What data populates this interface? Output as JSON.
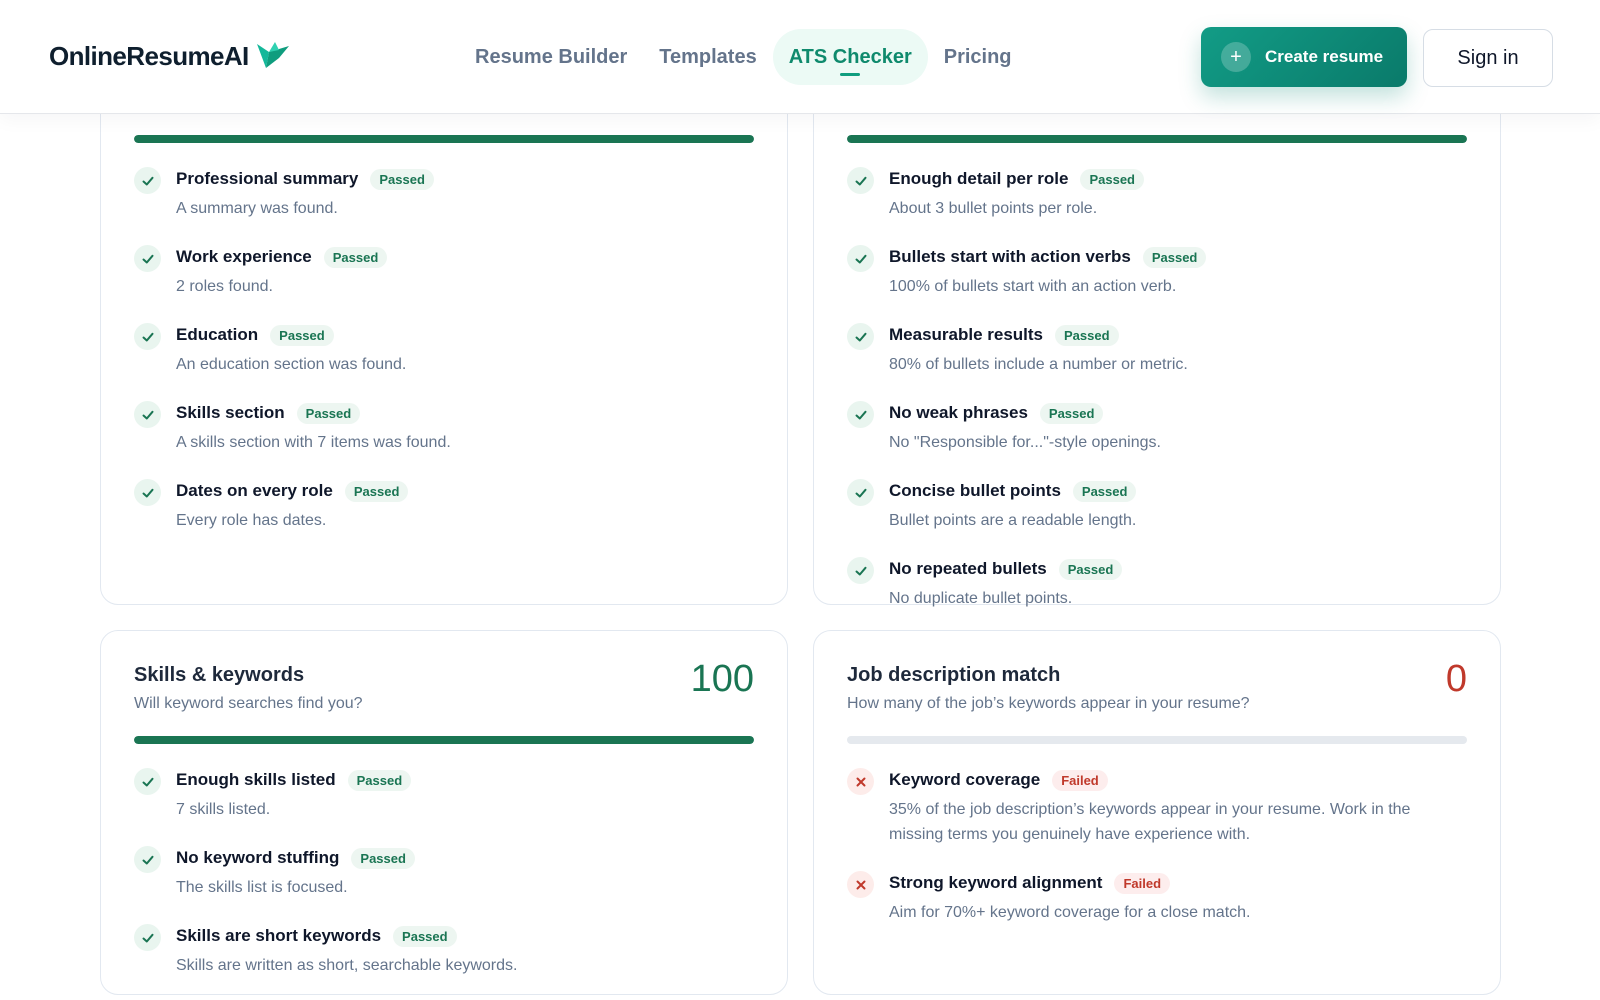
{
  "brand": {
    "name": "OnlineResumeAI",
    "accent": "#0f9d7e",
    "icon": "bird-logo-icon"
  },
  "nav": {
    "items": [
      {
        "label": "Resume Builder",
        "active": false
      },
      {
        "label": "Templates",
        "active": false
      },
      {
        "label": "ATS Checker",
        "active": true
      },
      {
        "label": "Pricing",
        "active": false
      }
    ]
  },
  "header_actions": {
    "create_label": "Create resume",
    "create_icon": "plus-icon",
    "signin_label": "Sign in"
  },
  "cards": {
    "sections": {
      "progress": 1.0,
      "items": [
        {
          "title": "Professional summary",
          "status": "Passed",
          "desc": "A summary was found."
        },
        {
          "title": "Work experience",
          "status": "Passed",
          "desc": "2 roles found."
        },
        {
          "title": "Education",
          "status": "Passed",
          "desc": "An education section was found."
        },
        {
          "title": "Skills section",
          "status": "Passed",
          "desc": "A skills section with 7 items was found."
        },
        {
          "title": "Dates on every role",
          "status": "Passed",
          "desc": "Every role has dates."
        }
      ]
    },
    "bullets": {
      "progress": 1.0,
      "items": [
        {
          "title": "Enough detail per role",
          "status": "Passed",
          "desc": "About 3 bullet points per role."
        },
        {
          "title": "Bullets start with action verbs",
          "status": "Passed",
          "desc": "100% of bullets start with an action verb."
        },
        {
          "title": "Measurable results",
          "status": "Passed",
          "desc": "80% of bullets include a number or metric."
        },
        {
          "title": "No weak phrases",
          "status": "Passed",
          "desc": "No \"Responsible for...\"-style openings."
        },
        {
          "title": "Concise bullet points",
          "status": "Passed",
          "desc": "Bullet points are a readable length."
        },
        {
          "title": "No repeated bullets",
          "status": "Passed",
          "desc": "No duplicate bullet points."
        }
      ]
    },
    "skills": {
      "title": "Skills & keywords",
      "subtitle": "Will keyword searches find you?",
      "score": "100",
      "progress": 1.0,
      "items": [
        {
          "title": "Enough skills listed",
          "status": "Passed",
          "desc": "7 skills listed."
        },
        {
          "title": "No keyword stuffing",
          "status": "Passed",
          "desc": "The skills list is focused."
        },
        {
          "title": "Skills are short keywords",
          "status": "Passed",
          "desc": "Skills are written as short, searchable keywords."
        }
      ]
    },
    "jobmatch": {
      "title": "Job description match",
      "subtitle": "How many of the job’s keywords appear in your resume?",
      "score": "0",
      "progress": 0,
      "items": [
        {
          "title": "Keyword coverage",
          "status": "Failed",
          "desc": "35% of the job description’s keywords appear in your resume. Work in the missing terms you genuinely have experience with."
        },
        {
          "title": "Strong keyword alignment",
          "status": "Failed",
          "desc": "Aim for 70%+ keyword coverage for a close match."
        }
      ]
    }
  },
  "colors": {
    "pass": "#1a7553",
    "fail": "#c0392b",
    "track": "#e5e9ee"
  }
}
